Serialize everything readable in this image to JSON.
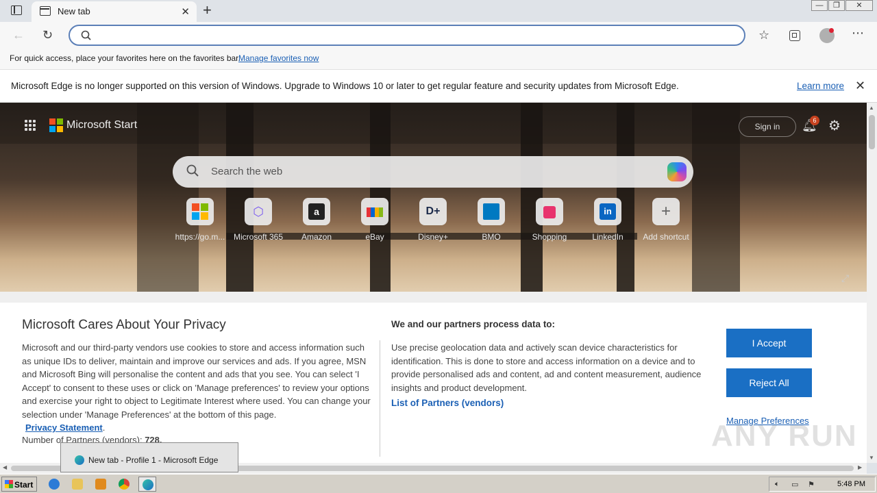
{
  "browser": {
    "tab_title": "New tab",
    "tab_close": "✕",
    "new_tab": "+",
    "address_value": "",
    "window_controls": [
      "—",
      "❐",
      "✕"
    ]
  },
  "favbar": {
    "text": "For quick access, place your favorites here on the favorites bar.",
    "link": "Manage favorites now"
  },
  "infobar": {
    "message": "Microsoft Edge is no longer supported on this version of Windows. Upgrade to Windows 10 or later to get regular feature and security updates from Microsoft Edge.",
    "link": "Learn more",
    "close": "✕"
  },
  "start": {
    "brand": "Microsoft Start",
    "sign_in": "Sign in",
    "notification_count": "6",
    "search_placeholder": "Search the web",
    "shortcuts": [
      {
        "label": "https://go.m...",
        "icon": "windows-logo-icon"
      },
      {
        "label": "Microsoft 365",
        "icon": "microsoft-365-icon"
      },
      {
        "label": "Amazon",
        "icon": "amazon-icon"
      },
      {
        "label": "eBay",
        "icon": "ebay-icon"
      },
      {
        "label": "Disney+",
        "icon": "disney-plus-icon"
      },
      {
        "label": "BMO",
        "icon": "bmo-icon"
      },
      {
        "label": "Shopping",
        "icon": "shopping-bag-icon"
      },
      {
        "label": "LinkedIn",
        "icon": "linkedin-icon"
      },
      {
        "label": "Add shortcut",
        "icon": "plus-icon"
      }
    ]
  },
  "privacy": {
    "title": "Microsoft Cares About Your Privacy",
    "body": "Microsoft and our third-party vendors use cookies to store and access information such as unique IDs to deliver, maintain and improve our services and ads. If you agree, MSN and Microsoft Bing will personalise the content and ads that you see. You can select 'I Accept' to consent to these uses or click on 'Manage preferences' to review your options and exercise your right to object to Legitimate Interest where used.  You can change your selection under 'Manage Preferences' at the bottom of this page.",
    "privacy_link": "Privacy Statement",
    "partners_label": "Number of Partners (vendors): ",
    "partners_count": "728.",
    "heading2": "We and our partners process data to:",
    "body2": "Use precise geolocation data and actively scan device characteristics for identification. This is done to store and access information on a device and to provide personalised ads and content, ad and content measurement, audience insights and product development.",
    "partners_link": "List of Partners (vendors)",
    "accept": "I Accept",
    "reject": "Reject All",
    "manage": "Manage Preferences"
  },
  "taskbar": {
    "start": "Start",
    "thumbnail_title": "New tab - Profile 1 - Microsoft Edge",
    "clock": "5:48 PM"
  },
  "watermark": "ANY RUN",
  "colors": {
    "accent": "#1a6fc4",
    "link": "#1a5fb4",
    "address_border": "#5b7fb7"
  }
}
